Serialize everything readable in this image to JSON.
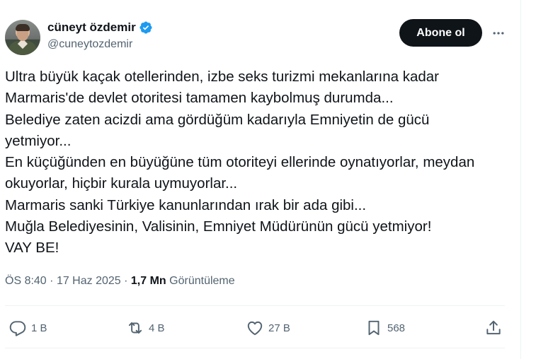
{
  "user": {
    "display_name": "cüneyt özdemir",
    "handle": "@cuneytozdemir",
    "verified_icon": "verified-badge-icon",
    "verified_color": "#1d9bf0"
  },
  "follow_button": {
    "label": "Abone ol",
    "background": "#0f1419"
  },
  "tweet": {
    "lines": [
      "Ultra büyük kaçak otellerinden, izbe seks turizmi mekanlarına kadar",
      "Marmaris'de devlet otoritesi tamamen kaybolmuş durumda...",
      "Belediye zaten acizdi ama gördüğüm kadarıyla Emniyetin de gücü",
      "yetmiyor...",
      "En küçüğünden en büyüğüne tüm otoriteyi ellerinde oynatıyorlar, meydan",
      "okuyorlar, hiçbir kurala uymuyorlar...",
      "Marmaris sanki Türkiye kanunlarından ırak bir ada gibi...",
      "Muğla Belediyesinin, Valisinin, Emniyet Müdürünün gücü yetmiyor!",
      "VAY BE!"
    ]
  },
  "meta": {
    "time": "ÖS 8:40",
    "separator": "·",
    "date": "17 Haz 2025",
    "views_count": "1,7 Mn",
    "views_label": "Görüntüleme"
  },
  "actions": {
    "replies": {
      "icon": "reply-icon",
      "count": "1 B"
    },
    "retweets": {
      "icon": "retweet-icon",
      "count": "4 B"
    },
    "likes": {
      "icon": "heart-icon",
      "count": "27 B"
    },
    "bookmarks": {
      "icon": "bookmark-icon",
      "count": "568"
    },
    "share": {
      "icon": "share-icon"
    }
  },
  "colors": {
    "text": "#0f1419",
    "secondary": "#536471",
    "divider": "#eff3f4"
  }
}
